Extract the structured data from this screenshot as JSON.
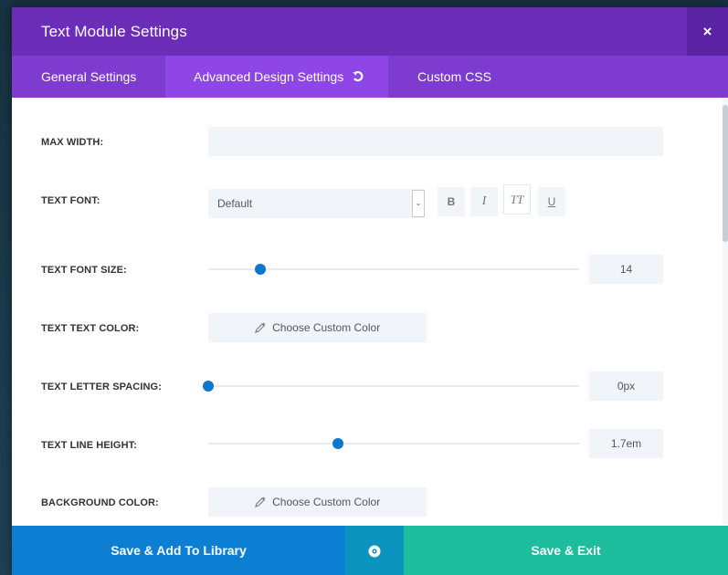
{
  "modal": {
    "title": "Text Module Settings",
    "close_label": "×"
  },
  "tabs": [
    {
      "label": "General Settings",
      "active": false
    },
    {
      "label": "Advanced Design Settings",
      "active": true
    },
    {
      "label": "Custom CSS",
      "active": false
    }
  ],
  "fields": {
    "max_width": {
      "label": "MAX WIDTH:",
      "value": ""
    },
    "text_font": {
      "label": "TEXT FONT:",
      "selected": "Default",
      "style_buttons": [
        "B",
        "I",
        "TT",
        "U"
      ],
      "active_style": "TT"
    },
    "text_font_size": {
      "label": "TEXT FONT SIZE:",
      "value": "14",
      "fraction": 0.14
    },
    "text_text_color": {
      "label": "TEXT TEXT COLOR:",
      "button_label": "Choose Custom Color"
    },
    "text_letter_spacing": {
      "label": "TEXT LETTER SPACING:",
      "value": "0px",
      "fraction": 0.0
    },
    "text_line_height": {
      "label": "TEXT LINE HEIGHT:",
      "value": "1.7em",
      "fraction": 0.35
    },
    "background_color": {
      "label": "BACKGROUND COLOR:",
      "button_label": "Choose Custom Color"
    }
  },
  "footer": {
    "library_label": "Save & Add To Library",
    "preview_icon": "eye-icon",
    "exit_label": "Save & Exit"
  },
  "colors": {
    "header": "#6c2eb9",
    "tabs": "#7e3bd0",
    "active_tab": "#8f46e6",
    "slider": "#0c77d0",
    "library_button": "#0c7fd3",
    "exit_button": "#1ebd9d"
  }
}
